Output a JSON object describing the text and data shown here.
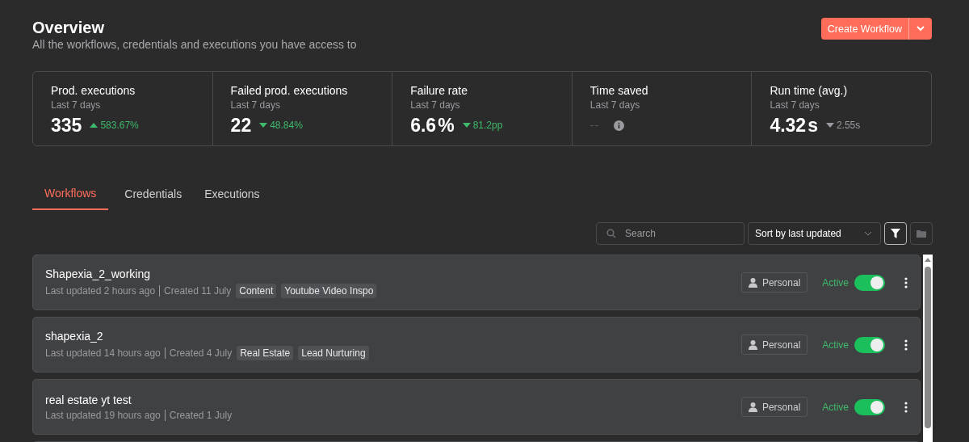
{
  "header": {
    "title": "Overview",
    "subtitle": "All the workflows, credentials and executions you have access to",
    "create_button": "Create Workflow"
  },
  "stats": [
    {
      "label": "Prod. executions",
      "period": "Last 7 days",
      "value": "335",
      "rising": true,
      "good": true,
      "change": "583.67%",
      "kind": "value"
    },
    {
      "label": "Failed prod. executions",
      "period": "Last 7 days",
      "value": "22",
      "rising": false,
      "good": true,
      "change": "48.84%",
      "kind": "value"
    },
    {
      "label": "Failure rate",
      "period": "Last 7 days",
      "value": "6.6",
      "unit": "%",
      "rising": false,
      "good": true,
      "change": "81.2pp",
      "kind": "value"
    },
    {
      "label": "Time saved",
      "period": "Last 7 days",
      "value": "--",
      "kind": "empty"
    },
    {
      "label": "Run time (avg.)",
      "period": "Last 7 days",
      "value": "4.32",
      "unit": "s",
      "rising": false,
      "good": false,
      "change": "2.55s",
      "kind": "value"
    }
  ],
  "tabs": [
    {
      "label": "Workflows",
      "selected": true
    },
    {
      "label": "Credentials",
      "selected": false
    },
    {
      "label": "Executions",
      "selected": false
    }
  ],
  "toolbar": {
    "search_placeholder": "Search",
    "sort": "Sort by last updated"
  },
  "workflows": [
    {
      "name": "Shapexia_2_working",
      "updated": "Last updated 2 hours ago",
      "created": "Created 11 July",
      "tags": [
        "Content",
        "Youtube Video Inspo"
      ],
      "owner": "Personal",
      "status": "Active",
      "active": true
    },
    {
      "name": "shapexia_2",
      "updated": "Last updated 14 hours ago",
      "created": "Created 4 July",
      "tags": [
        "Real Estate",
        "Lead Nurturing"
      ],
      "owner": "Personal",
      "status": "Active",
      "active": true
    },
    {
      "name": "real estate yt test",
      "updated": "Last updated 19 hours ago",
      "created": "Created 1 July",
      "owner": "Personal",
      "status": "Active",
      "active": true
    }
  ]
}
